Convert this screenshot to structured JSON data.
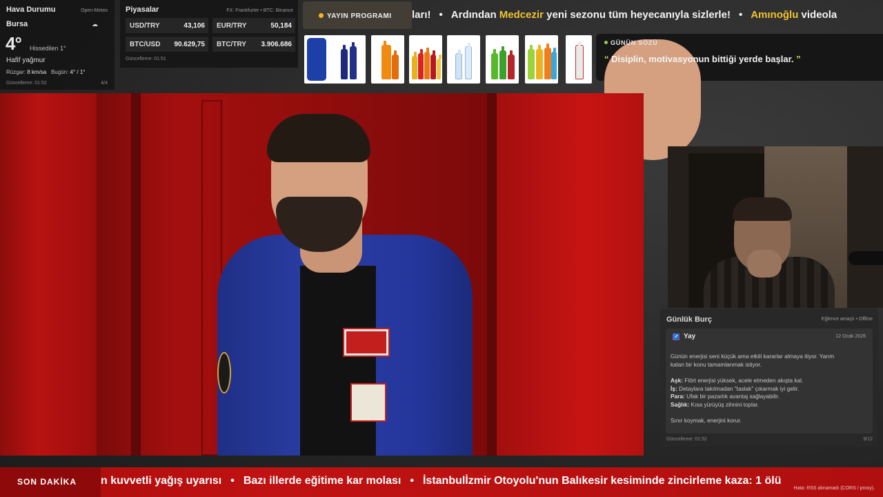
{
  "weather": {
    "title": "Hava Durumu",
    "source": "Open-Meteo",
    "city": "Bursa",
    "icon": "cloud-icon",
    "icon_glyph": "☁",
    "temperature": "4°",
    "feels_like": "Hissedilen 1°",
    "condition": "Hafif yağmur",
    "wind_label": "Rüzgar:",
    "wind_value": "8 km/sa",
    "today_label": "Bugün:",
    "today_value": "4° / 1°",
    "updated": "Güncelleme: 01:52",
    "page": "4/4"
  },
  "markets": {
    "title": "Piyasalar",
    "source": "FX: Frankfurter • BTC: Binance",
    "items": [
      {
        "label": "USD/TRY",
        "value": "43,106"
      },
      {
        "label": "EUR/TRY",
        "value": "50,184"
      },
      {
        "label": "BTC/USD",
        "value": "90.629,75"
      },
      {
        "label": "BTC/TRY",
        "value": "3.906.686"
      }
    ],
    "updated": "Güncelleme: 01:51"
  },
  "top_ticker": {
    "schedule_label": "YAYIN PROGRAMI",
    "part1": "ları!",
    "sep": "•",
    "part2_pre": "Ardından",
    "part2_hl": "Medcezir",
    "part2_post": "yeni sezonu tüm heyecanıyla sizlerle!",
    "part3_hl": "Amınoğlu",
    "part3_post": "videola"
  },
  "quote": {
    "heading": "GÜNÜN SÖZÜ",
    "open_mark": "“",
    "text": "Disiplin, motivasyonun bittiği yerde başlar.",
    "close_mark": "”"
  },
  "horoscope": {
    "title": "Günlük Burç",
    "meta": "Eğlence amaçlı • Offline",
    "sign_glyph": "♐",
    "sign": "Yay",
    "date": "12 Ocak 2026",
    "intro_1": "Günün enerjisi seni küçük ama etkili kararlar almaya itiyor. Yarım",
    "intro_2": "kalan bir konu tamamlanmak istiyor.",
    "love_label": "Aşk:",
    "love": "Flört enerjisi yüksek, acele etmeden akışta kal.",
    "work_label": "İş:",
    "work": "Detaylara takılmadan \"taslak\" çıkarmak iyi gelir.",
    "money_label": "Para:",
    "money": "Ufak bir pazarlık avantaj sağlayabilir.",
    "health_label": "Sağlık:",
    "health": "Kısa yürüyüş zihnini toplar.",
    "closing": "Sınır koymak, enerjini korur.",
    "updated": "Güncelleme: 01:52",
    "page": "9/12"
  },
  "breaking": {
    "label": "SON DAKİKA",
    "item1": "n kuvvetli yağış uyarısı",
    "sep": "•",
    "item2": "Bazı illerde eğitime kar molası",
    "item3": "İstanbulİzmir Otoyolu'nun Balıkesir kesiminde zincirleme kaza: 1 ölü",
    "error": "Hata: RSS alınamadı (CORS / proxy)."
  },
  "colors": {
    "accent_yellow": "#f2c230",
    "accent_green": "#b9e255",
    "breaking_red": "#c01212"
  }
}
